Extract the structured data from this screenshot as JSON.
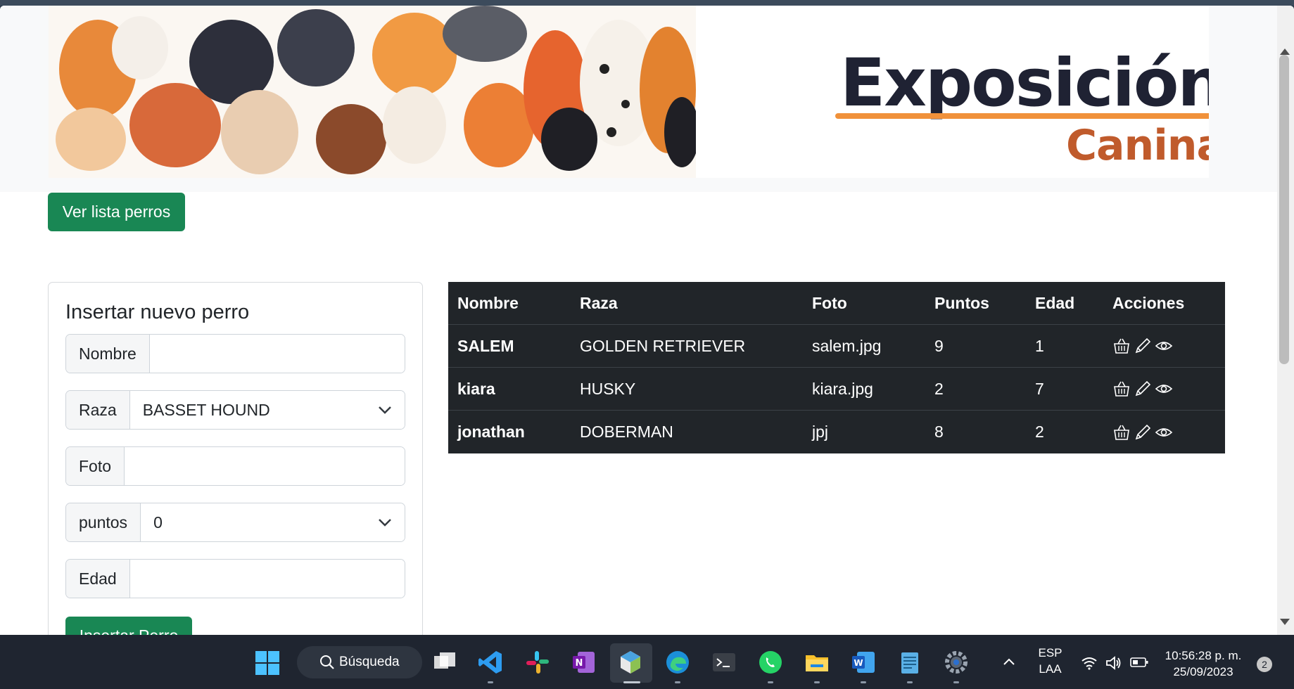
{
  "banner": {
    "title_line1": "Exposición",
    "title_line2": "Canina"
  },
  "buttons": {
    "ver_lista": "Ver lista perros",
    "insertar": "Insertar Perro"
  },
  "form": {
    "title": "Insertar nuevo perro",
    "fields": {
      "nombre": {
        "label": "Nombre",
        "value": ""
      },
      "raza": {
        "label": "Raza",
        "value": "BASSET HOUND"
      },
      "foto": {
        "label": "Foto",
        "value": ""
      },
      "puntos": {
        "label": "puntos",
        "value": "0"
      },
      "edad": {
        "label": "Edad",
        "value": ""
      }
    }
  },
  "table": {
    "headers": [
      "Nombre",
      "Raza",
      "Foto",
      "Puntos",
      "Edad",
      "Acciones"
    ],
    "rows": [
      {
        "nombre": "SALEM",
        "raza": "GOLDEN RETRIEVER",
        "foto": "salem.jpg",
        "puntos": "9",
        "edad": "1"
      },
      {
        "nombre": "kiara",
        "raza": "HUSKY",
        "foto": "kiara.jpg",
        "puntos": "2",
        "edad": "7"
      },
      {
        "nombre": "jonathan",
        "raza": "DOBERMAN",
        "foto": "jpj",
        "puntos": "8",
        "edad": "2"
      }
    ],
    "action_icons": [
      "basket-icon",
      "pencil-icon",
      "eye-icon"
    ]
  },
  "taskbar": {
    "search_label": "Búsqueda",
    "language": "ESP",
    "layout": "LAA",
    "time": "10:56:28 p. m.",
    "date": "25/09/2023",
    "notifications": "2"
  },
  "colors": {
    "primary_green": "#198754",
    "table_dark": "#212529",
    "banner_orange": "#f0913a",
    "banner_rust": "#c05b2c"
  }
}
